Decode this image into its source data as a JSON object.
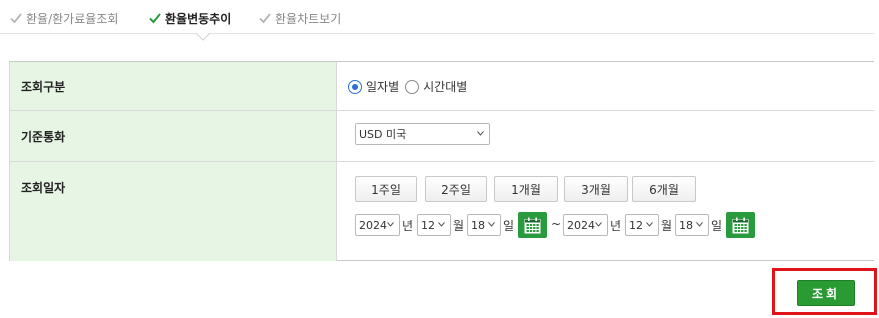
{
  "tabs": [
    {
      "label": "환율/환가료율조회",
      "active": false
    },
    {
      "label": "환율변동추이",
      "active": true
    },
    {
      "label": "환율차트보기",
      "active": false
    }
  ],
  "form": {
    "inquiry_type": {
      "label": "조회구분",
      "options": [
        "일자별",
        "시간대별"
      ],
      "selected": "일자별"
    },
    "currency": {
      "label": "기준통화",
      "value": "USD 미국"
    },
    "inquiry_date": {
      "label": "조회일자",
      "period_buttons": [
        "1주일",
        "2주일",
        "1개월",
        "3개월",
        "6개월"
      ],
      "from": {
        "year": "2024",
        "month": "12",
        "day": "18"
      },
      "to": {
        "year": "2024",
        "month": "12",
        "day": "18"
      },
      "year_unit": "년",
      "month_unit": "월",
      "day_unit": "일",
      "range_separator": "~"
    }
  },
  "search_button": {
    "label": "조회"
  },
  "colors": {
    "header_cell_bg": "#e7f6e4",
    "accent_green": "#2a9a3e",
    "radio_selected": "#2a6fd1",
    "highlight_box": "#e0131a"
  }
}
